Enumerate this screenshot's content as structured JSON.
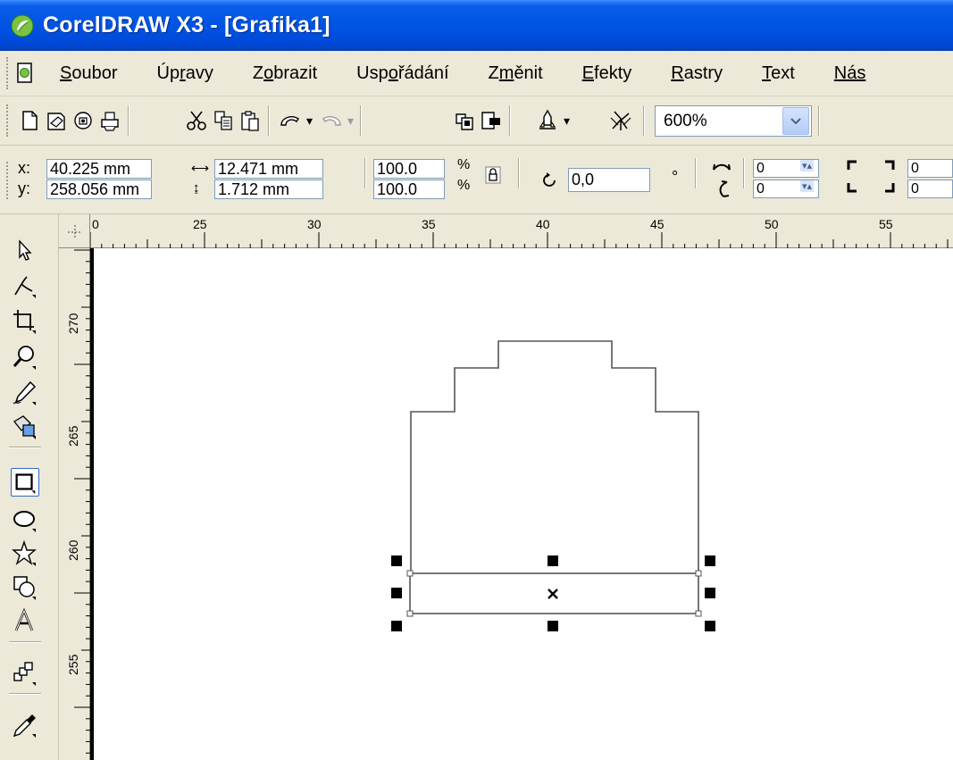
{
  "window": {
    "title": "CorelDRAW X3 - [Grafika1]"
  },
  "menu": {
    "items": [
      {
        "pre": "",
        "ul": "S",
        "post": "oubor"
      },
      {
        "pre": "Úp",
        "ul": "r",
        "post": "avy"
      },
      {
        "pre": "Z",
        "ul": "o",
        "post": "brazit"
      },
      {
        "pre": "Usp",
        "ul": "o",
        "post": "řádání"
      },
      {
        "pre": "Z",
        "ul": "m",
        "post": "ěnit"
      },
      {
        "pre": "",
        "ul": "E",
        "post": "fekty"
      },
      {
        "pre": "",
        "ul": "R",
        "post": "astry"
      },
      {
        "pre": "",
        "ul": "T",
        "post": "ext"
      },
      {
        "pre": "",
        "ul": "Nás",
        "post": ""
      }
    ]
  },
  "toolbar": {
    "zoom_value": "600%",
    "icons": [
      "new-icon",
      "open-icon",
      "save-icon",
      "print-icon",
      "cut-icon",
      "copy-icon",
      "paste-icon",
      "undo-icon",
      "redo-icon",
      "import-icon",
      "export-icon",
      "application-launcher-icon",
      "welcome-screen-icon"
    ]
  },
  "property_bar": {
    "x_label": "x:",
    "y_label": "y:",
    "x_value": "40.225 mm",
    "y_value": "258.056 mm",
    "width_value": "12.471 mm",
    "height_value": "1.712 mm",
    "scale_x": "100.0",
    "scale_y": "100.0",
    "percent": "%",
    "rotation_value": "0,0",
    "degree": "°",
    "corner_tl": "0",
    "corner_bl": "0",
    "corner_tr": "0",
    "corner_br": "0"
  },
  "rulers": {
    "horizontal_ticks": [
      "0",
      "25",
      "30",
      "35",
      "40",
      "45",
      "50",
      "55"
    ],
    "vertical_ticks": [
      "270",
      "265",
      "260",
      "255"
    ]
  },
  "toolbox": {
    "tools": [
      "pick-tool-icon",
      "shape-tool-icon",
      "crop-tool-icon",
      "zoom-tool-icon",
      "freehand-tool-icon",
      "smart-fill-tool-icon",
      "rectangle-tool-icon",
      "ellipse-tool-icon",
      "polygon-tool-icon",
      "basic-shapes-tool-icon",
      "text-tool-icon",
      "interactive-blend-tool-icon",
      "eyedropper-tool-icon"
    ],
    "active_tool": "rectangle-tool-icon"
  },
  "colors": {
    "titlebar": "#0054e3",
    "chrome": "#ece9d8",
    "selection_accent": "#316ac5"
  }
}
